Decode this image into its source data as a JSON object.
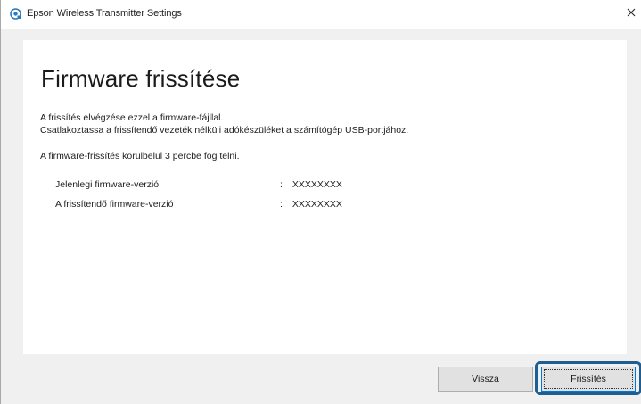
{
  "window": {
    "title": "Epson Wireless Transmitter Settings",
    "close_glyph": "×"
  },
  "page": {
    "heading": "Firmware frissítése",
    "description_line1": "A frissítés elvégzése ezzel a firmware-fájllal.",
    "description_line2": "Csatlakoztassa a frissítendő vezeték nélküli adókészüléket a számítógép USB-portjához.",
    "duration_note": "A firmware-frissítés körülbelül 3 percbe fog telni."
  },
  "firmware_info": [
    {
      "label": "Jelenlegi firmware-verzió",
      "separator": ":",
      "value": "XXXXXXXX"
    },
    {
      "label": "A frissítendő firmware-verzió",
      "separator": ":",
      "value": "XXXXXXXX"
    }
  ],
  "buttons": {
    "back_label": "Vissza",
    "update_label": "Frissítés"
  },
  "colors": {
    "highlight_border": "#1f5e91",
    "app_icon": "#2a7abf"
  },
  "icons": {
    "app": "epson-app-icon",
    "close": "close-icon"
  }
}
